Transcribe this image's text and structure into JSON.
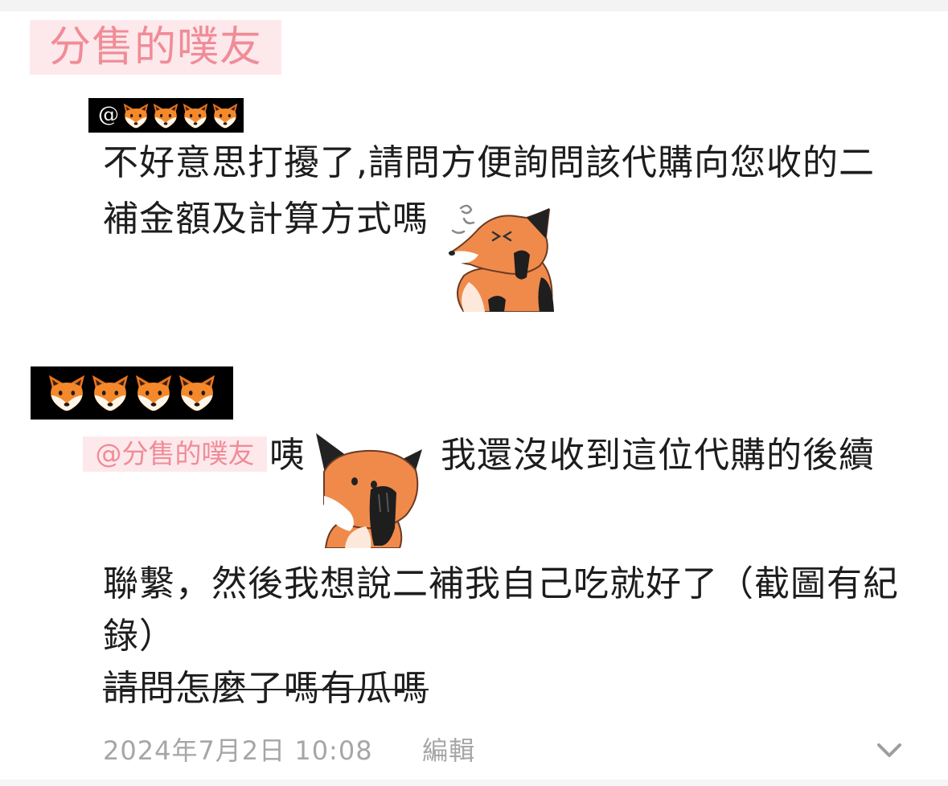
{
  "comments": [
    {
      "author": {
        "name": "分售的噗友"
      },
      "mention": {
        "prefix": "@",
        "icons": [
          "fox-face-icon",
          "fox-face-icon",
          "fox-face-icon",
          "fox-face-icon"
        ]
      },
      "lines": [
        "不好意思打擾了,請問方便詢問該代購向您收的二",
        "補金額及計算方式嗎"
      ],
      "sticker": "fox-covering-face-sticker"
    },
    {
      "author": {
        "icons": [
          "fox-face-icon",
          "fox-face-icon",
          "fox-face-icon",
          "fox-face-icon"
        ]
      },
      "mention": "@分售的噗友",
      "lines": [
        "咦",
        "我還沒收到這位代購的後續",
        "聯繫，然後我想說二補我自己吃就好了（截圖有紀",
        "錄）"
      ],
      "strikethrough_line": "請問怎麼了嗎有瓜嗎",
      "sticker": "fox-hand-on-mouth-sticker"
    }
  ],
  "footer": {
    "timestamp": "2024年7月2日 10:08",
    "edit_label": "編輯",
    "expand_icon": "chevron-down-icon"
  },
  "colors": {
    "accent_pink": "#f08c98",
    "pink_background": "#fde9eb",
    "name_box": "#000000",
    "text": "#1d1d1d",
    "meta_gray": "#a6a6a6"
  }
}
